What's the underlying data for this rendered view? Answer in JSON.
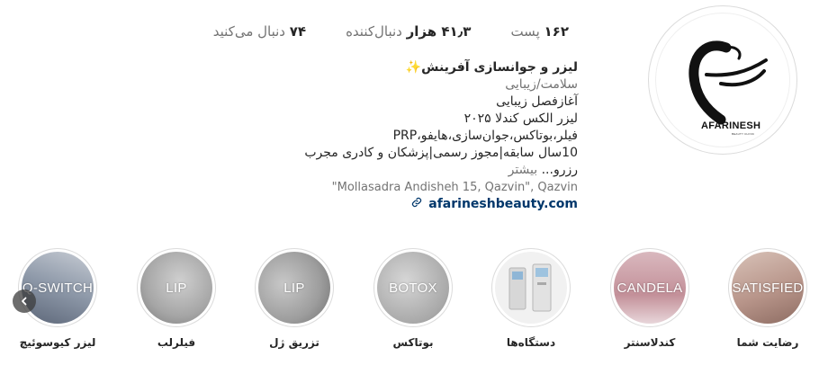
{
  "profile": {
    "avatar_brand": "AFARINESH",
    "avatar_subbrand": "BEAUTY CLINIC"
  },
  "stats": {
    "posts_count": "۱۶۲",
    "posts_label": "پست",
    "followers_count": "۴۱٫۳ هزار",
    "followers_label": "دنبال‌کننده",
    "following_count": "۷۴",
    "following_label": "دنبال می‌کنید"
  },
  "bio": {
    "name": "لیزر و جوانسازی آفرینش",
    "name_emoji": "✨",
    "category": "سلامت/زیبایی",
    "line1": "آغازفصل زیبایی",
    "line2": "لیزر الکس کندلا ۲۰۲۵",
    "line3": "فیلر،بوتاکس،جوان‌سازی،هایفو،PRP",
    "line4": "10سال سابقه|مجوز رسمی|پزشکان و کادری مجرب",
    "line5": "رزرو... ",
    "more": "بیشتر",
    "address": "\"Mollasadra Andisheh 15, Qazvin\", Qazvin",
    "website": "afarineshbeauty.com"
  },
  "highlights": [
    {
      "label": "رضایت شما",
      "overlay": "SATISFIED",
      "color": "#c9a79c"
    },
    {
      "label": "کندلاسنتر",
      "overlay": "CANDELA",
      "color": "#c9a3a8"
    },
    {
      "label": "دستگاه‌ها",
      "overlay": "",
      "color": "#e8e8e8"
    },
    {
      "label": "بوتاکس",
      "overlay": "BOTOX",
      "color": "#b9b9b9"
    },
    {
      "label": "تزریق ژل",
      "overlay": "LIP",
      "color": "#a8a8a8"
    },
    {
      "label": "فیلرلب",
      "overlay": "LIP",
      "color": "#b5b5b5"
    },
    {
      "label": "لیزر کیوسوئیچ",
      "overlay": "Q-SWITCH",
      "color": "#8f9bab"
    }
  ],
  "icons": {
    "link": "link-icon",
    "scroll": "chevron-left-icon"
  }
}
